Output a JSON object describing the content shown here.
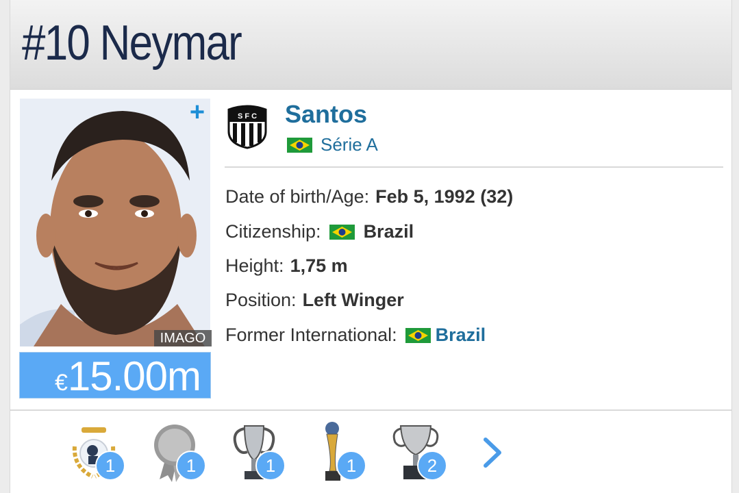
{
  "header": {
    "title": "#10 Neymar"
  },
  "photo": {
    "credit": "IMAGO",
    "add_label": "+"
  },
  "market_value": {
    "currency": "€",
    "amount": "15.00m"
  },
  "club": {
    "name": "Santos",
    "league": "Série A"
  },
  "info": [
    {
      "label": "Date of birth/Age:",
      "value": "Feb 5, 1992 (32)"
    },
    {
      "label": "Citizenship:",
      "value": "Brazil",
      "flag": "brazil-flag"
    },
    {
      "label": "Height:",
      "value": "1,75 m"
    },
    {
      "label": "Position:",
      "value": "Left Winger"
    },
    {
      "label": "Former International:",
      "value": "Brazil",
      "flag": "brazil-flag"
    }
  ],
  "trophies": [
    {
      "icon": "laurel-award-icon",
      "count": "1"
    },
    {
      "icon": "medal-rosette-icon",
      "count": "1"
    },
    {
      "icon": "champions-league-trophy-icon",
      "count": "1"
    },
    {
      "icon": "club-world-cup-trophy-icon",
      "count": "1"
    },
    {
      "icon": "cup-trophy-icon",
      "count": "2"
    }
  ],
  "colors": {
    "link_blue": "#1f6e9c",
    "value_blue": "#5aa9f5",
    "title_navy": "#1b2a4a"
  }
}
